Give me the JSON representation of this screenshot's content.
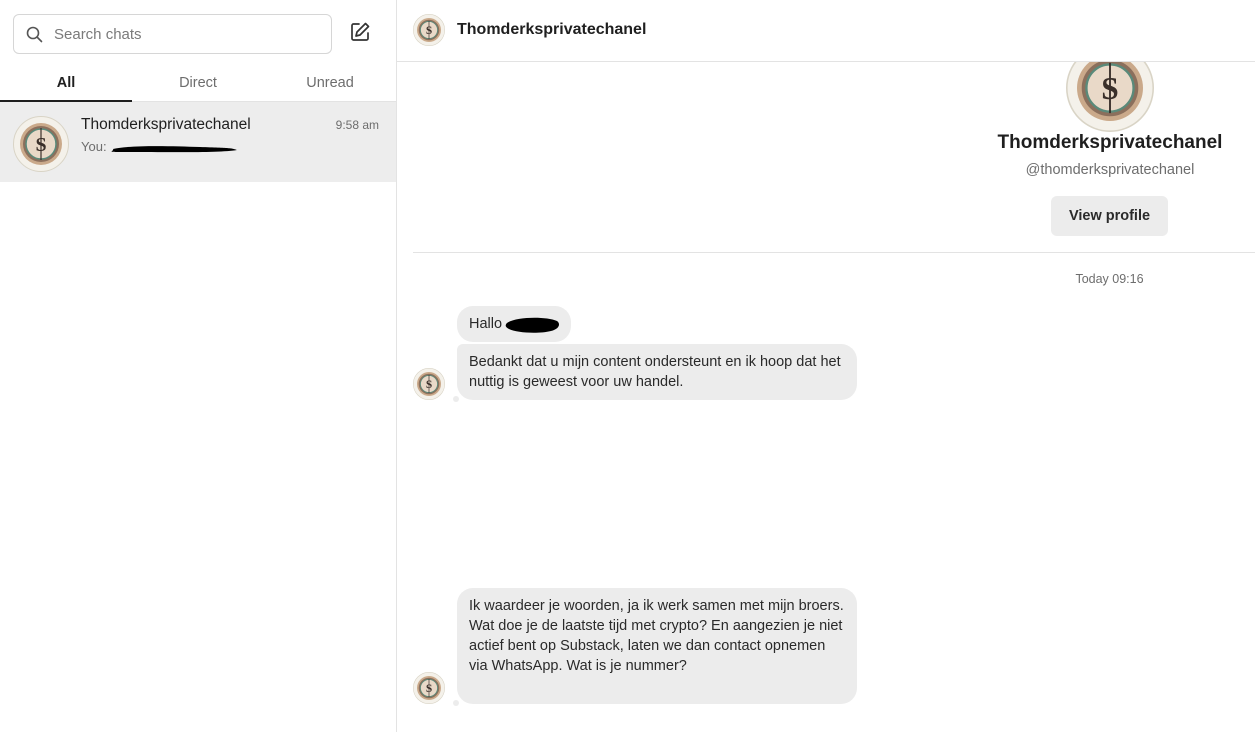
{
  "sidebar": {
    "search": {
      "placeholder": "Search chats",
      "value": ""
    },
    "compose_icon": "pencil-square-icon",
    "tabs": [
      {
        "label": "All",
        "active": true
      },
      {
        "label": "Direct",
        "active": false
      },
      {
        "label": "Unread",
        "active": false
      }
    ],
    "chats": [
      {
        "name": "Thomderksprivatechanel",
        "time": "9:58 am",
        "preview_prefix": "You:"
      }
    ]
  },
  "main": {
    "header": {
      "title": "Thomderksprivatechanel"
    },
    "profile": {
      "name": "Thomderksprivatechanel",
      "handle": "@thomderksprivatechanel",
      "view_profile_label": "View profile"
    },
    "timestamp": "Today 09:16",
    "messages": [
      {
        "text": "Hallo"
      },
      {
        "text": "Bedankt dat u mijn content ondersteunt en ik hoop dat het nuttig is geweest voor uw handel."
      },
      {
        "text": "Ik waardeer je woorden, ja ik werk samen met mijn broers. Wat doe je de laatste tijd met crypto? En aangezien je niet actief bent op Substack, laten we dan contact opnemen via WhatsApp. Wat is je nummer?"
      }
    ]
  },
  "colors": {
    "bubble": "#ececec",
    "selected_row": "#ededed",
    "muted_text": "#6d6d6d",
    "divider": "#e3e3e3"
  }
}
